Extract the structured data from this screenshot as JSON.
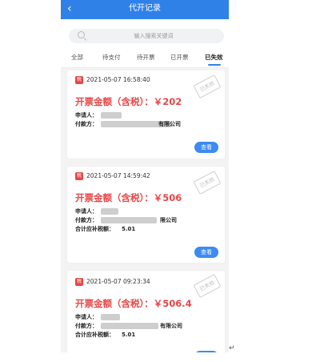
{
  "header": {
    "back_icon": "‹",
    "title": "代开记录"
  },
  "search": {
    "placeholder": "输入搜索关键词"
  },
  "tabs": [
    {
      "label": "全部",
      "active": false
    },
    {
      "label": "待支付",
      "active": false
    },
    {
      "label": "待开票",
      "active": false
    },
    {
      "label": "已开票",
      "active": false
    },
    {
      "label": "已失效",
      "active": true
    }
  ],
  "records": [
    {
      "badge": "税",
      "datetime": "2021-05-07 16:58:40",
      "status_stamp": "已失效",
      "amount": "开票金额（含税）：￥202",
      "applicant_label": "申请人：",
      "payer_label": "付款方：",
      "payer_value": "有限公司",
      "supplement_label": "",
      "supplement_value": "",
      "view_button": "查看"
    },
    {
      "badge": "税",
      "datetime": "2021-05-07 14:59:42",
      "status_stamp": "已失效",
      "amount": "开票金额（含税）：￥506",
      "applicant_label": "申请人：",
      "payer_label": "付款方：",
      "payer_value": "限公司",
      "supplement_label": "合计应补税额：",
      "supplement_value": "5.01",
      "view_button": "查看"
    },
    {
      "badge": "税",
      "datetime": "2021-05-07 09:23:34",
      "status_stamp": "已失效",
      "amount": "开票金额（含税）：￥506.4",
      "applicant_label": "申请人：",
      "payer_label": "付款方：",
      "payer_value": "有限公司",
      "supplement_label": "合计应补税额：",
      "supplement_value": "5.01",
      "view_button": "查看"
    }
  ],
  "paragraph_mark": "↵",
  "colors": {
    "primary": "#2f81e8",
    "accent_red": "#e64646",
    "stamp_gray": "#bdbdbd"
  }
}
